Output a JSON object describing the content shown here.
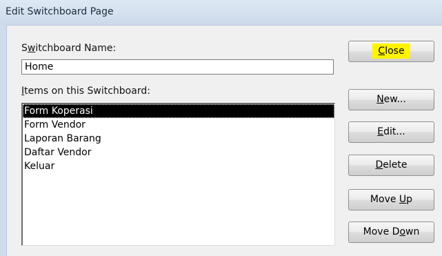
{
  "window": {
    "title": "Edit Switchboard Page"
  },
  "form": {
    "name_label_pre": "S",
    "name_label_acc": "w",
    "name_label_post": "itchboard Name:",
    "name_value": "Home",
    "items_label_acc": "I",
    "items_label_post": "tems on this Switchboard:",
    "items": [
      "Form Koperasi",
      "Form Vendor",
      "Laporan Barang",
      "Daftar Vendor",
      "Keluar"
    ],
    "selected_index": 0
  },
  "buttons": {
    "close_acc": "C",
    "close_post": "lose",
    "new_acc": "N",
    "new_post": "ew...",
    "edit_acc": "E",
    "edit_post": "dit...",
    "delete_acc": "D",
    "delete_post": "elete",
    "moveup_pre": "Move ",
    "moveup_acc": "U",
    "moveup_post": "p",
    "movedown_pre": "Move D",
    "movedown_acc": "o",
    "movedown_post": "wn"
  },
  "colors": {
    "highlight": "#fff400",
    "selection": "#000000"
  }
}
